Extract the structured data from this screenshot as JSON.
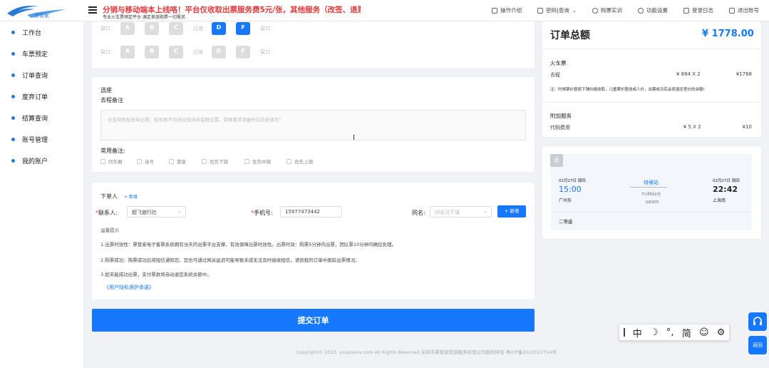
{
  "header": {
    "logo_text": "票管家",
    "notice": "分销与移动端本上线咯！平台仅收取出票服务费5元/张，其他服务（改签、退票、",
    "notice_sub": "专业火车票预定平台 满足差旅购票一切需求",
    "nav": [
      "操作介绍",
      "密码|查询",
      "购票实训",
      "功能设置",
      "登录日志",
      "退出账号"
    ]
  },
  "sidebar": {
    "items": [
      {
        "label": "工作台"
      },
      {
        "label": "车票预定"
      },
      {
        "label": "订单查询"
      },
      {
        "label": "废弃订单"
      },
      {
        "label": "结算查询"
      },
      {
        "label": "账号管理"
      },
      {
        "label": "我的账户"
      }
    ]
  },
  "seats": {
    "row1": {
      "left": "窗口",
      "mid": "过道",
      "right": "窗口",
      "letters": [
        "A",
        "B",
        "C",
        "D",
        "F"
      ]
    },
    "row2": {
      "left": "窗口",
      "mid": "过道",
      "right": "窗口",
      "letters": [
        "A",
        "B",
        "C",
        "D",
        "F"
      ]
    }
  },
  "remarks": {
    "section_title": "选座",
    "field_label": "去程备注",
    "placeholder": "仅支持附加坐单出票，如坐席不可自动支持并会联位置，特殊要求请备份在此处填写）",
    "common_label": "常用备注:",
    "options": [
      "同车厢",
      "连号",
      "靠窗",
      "优先下铺",
      "优先中铺",
      "优先上铺"
    ]
  },
  "orderer": {
    "title": "下单人",
    "add_link": "+ 新增",
    "contact_label": "联系人:",
    "contact_value": "超飞旅行社",
    "phone_label": "手机号:",
    "phone_value": "15977473442",
    "same_name_label": "同名:",
    "same_name_placeholder": "同名可不填",
    "add_button": "+ 新增",
    "tips_title": "温馨提示",
    "tips": [
      "1.出票时效性：票管家电子客票系统拥有当天的出票平台支撑，有效保障出票时效性。出票时效：购票5分钟内出票，团队票10分钟内确控处理。",
      "2.购票成功：购票成功后将短信通知您，您也可通过网关延迟可能导致未成无法及时接收短信，请到我的订单中跟踪出票情况。",
      "3.如未能成功出票，支付票款将自动退您系统余额中。"
    ],
    "privacy_link": "《用户隐私保护承诺》"
  },
  "submit_label": "提交订单",
  "footer": "Copyright© 2023. youpiaola.com All Rights Reserved 深圳市票管家旅游服务有限公司版权所有 粤ICP备2023022754号",
  "summary": {
    "title": "订单总额",
    "total": "¥ 1778.00",
    "ticket_section": "火车票",
    "ticket_row": {
      "name": "去程",
      "qty": "¥ 884 X 2",
      "amount": "¥1768"
    },
    "note": "注：时候票价暂按下铺价格收取，儿童票价暂收成人价，出票成功后会按退还差价的余额!",
    "extra_section": "附加服务",
    "extra_row": {
      "name": "代购费用",
      "qty": "¥ 5 X 2",
      "amount": "¥10"
    }
  },
  "trip": {
    "tag": "去",
    "dep_date": "02月27日 周四",
    "dep_time": "15:00",
    "dep_station": "广州东",
    "train_label": "待候站",
    "duration": "7小时42分",
    "train_no": "G6305",
    "arr_date": "02月27日 周四",
    "arr_time": "22:42",
    "arr_station": "上海南",
    "seat_class": "二等座"
  },
  "ime": [
    "中",
    "简"
  ],
  "float": {
    "support": "",
    "back": "返回"
  },
  "colors": {
    "accent": "#1677ff",
    "notice": "#e4393c",
    "price": "#1677ff"
  }
}
